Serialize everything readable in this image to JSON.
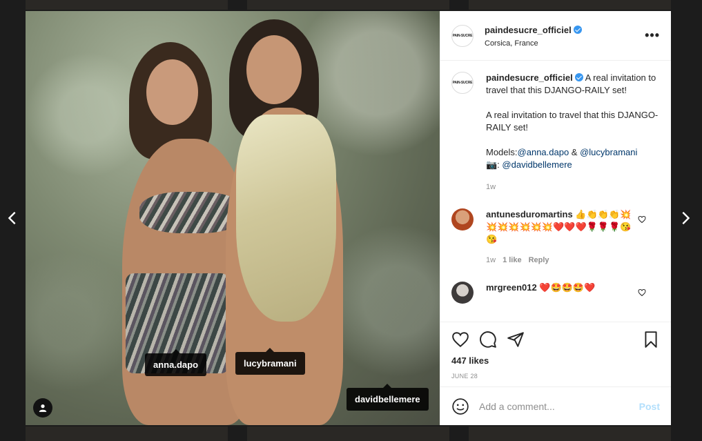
{
  "post": {
    "username": "paindesucre_officiel",
    "location": "Corsica, France",
    "avatar_text": "PAIN-SUCRE",
    "more_label": "•••"
  },
  "photo_tags": [
    {
      "label": "anna.dapo"
    },
    {
      "label": "lucybramani"
    },
    {
      "label": "davidbellemere"
    }
  ],
  "caption": {
    "username": "paindesucre_officiel",
    "text_1": " A real invitation to travel that this DJANGO-RAILY set!\n\nA real invitation to travel that this DJANGO-RAILY set!\n\nModels:",
    "mention_1": "@anna.dapo",
    "sep": " & ",
    "mention_2": "@lucybramani",
    "camera": "\n📷: ",
    "mention_3": "@davidbellemere",
    "time": "1w"
  },
  "comments": [
    {
      "username": "antunesduromartins",
      "text": " 👍👏👏👏💥💥💥💥💥💥💥❤️❤️❤️🌹🌹🌹😘😘",
      "time": "1w",
      "likes": "1 like",
      "reply": "Reply"
    },
    {
      "username": "mrgreen012",
      "text": " ❤️🤩🤩🤩❤️"
    }
  ],
  "likes": "447 likes",
  "date": "JUNE 28",
  "add_comment": {
    "placeholder": "Add a comment...",
    "post_label": "Post"
  },
  "colors": {
    "verified": "#3897f0",
    "link": "#00376b",
    "post_disabled": "#b2dffc"
  }
}
